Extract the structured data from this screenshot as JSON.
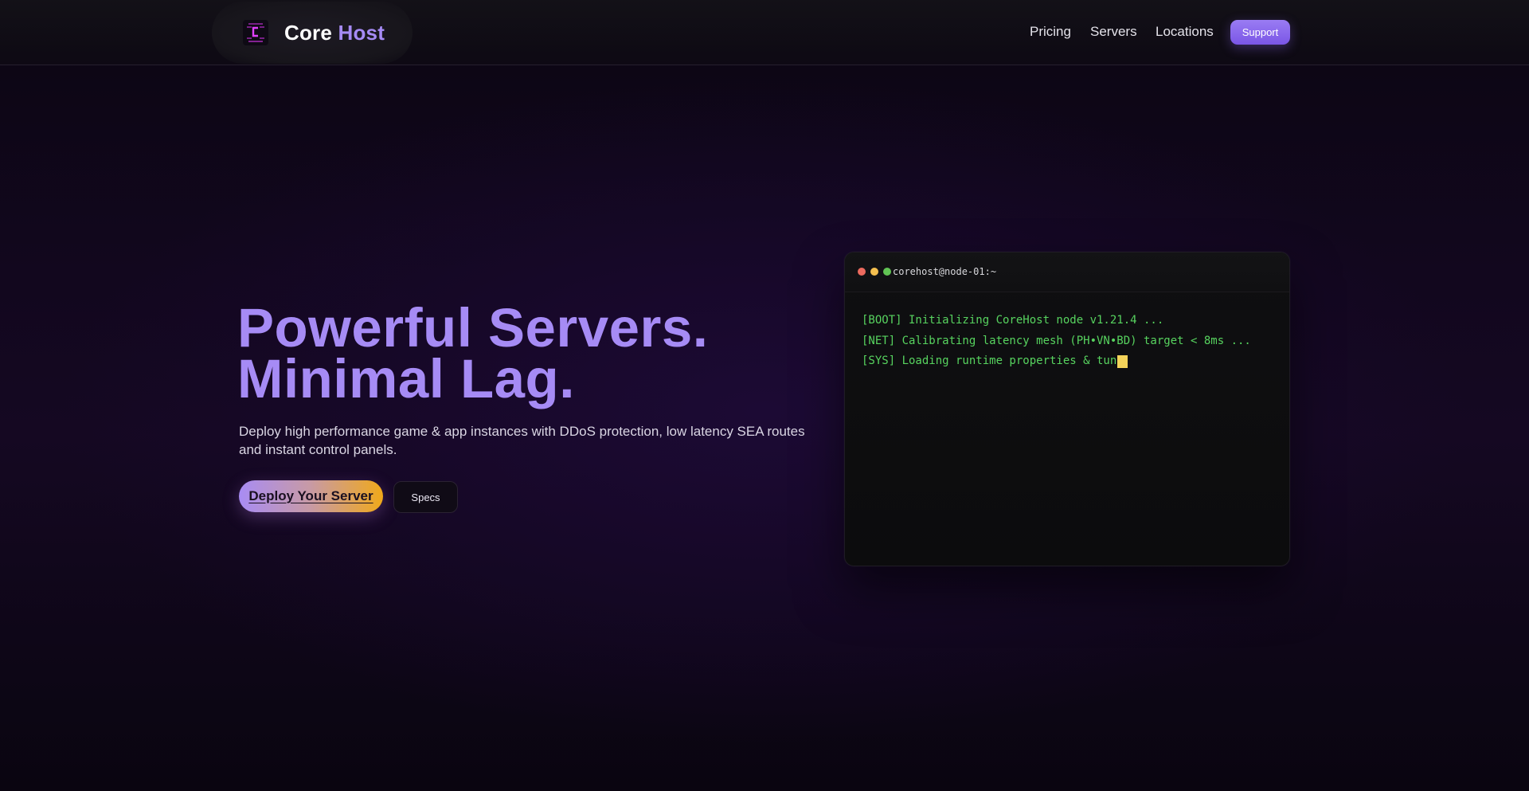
{
  "brand": {
    "name_part1": "Core",
    "name_part2": "Host",
    "logo_icon": "corehost-logo-icon"
  },
  "nav": {
    "links": [
      "Pricing",
      "Servers",
      "Locations"
    ],
    "support_label": "Support"
  },
  "hero": {
    "title_line1": "Powerful Servers.",
    "title_line2": "Minimal Lag.",
    "subtitle": "Deploy high performance game & app instances with DDoS protection, low latency SEA routes and instant control panels.",
    "primary_cta": "Deploy Your Server",
    "secondary_cta": "Specs"
  },
  "terminal": {
    "title": "corehost@node-01:~",
    "lines": [
      "[BOOT] Initializing CoreHost node v1.21.4 ...",
      "[NET] Calibrating latency mesh (PH•VN•BD) target < 8ms ...",
      "[SYS] Loading runtime properties & tun"
    ]
  },
  "colors": {
    "accent": "#a68bf5",
    "support_button": "#8a63f0",
    "cta_gradient_start": "#a88cf4",
    "cta_gradient_end": "#f0a91a",
    "terminal_text": "#57d35f",
    "cursor": "#f3d35a"
  }
}
